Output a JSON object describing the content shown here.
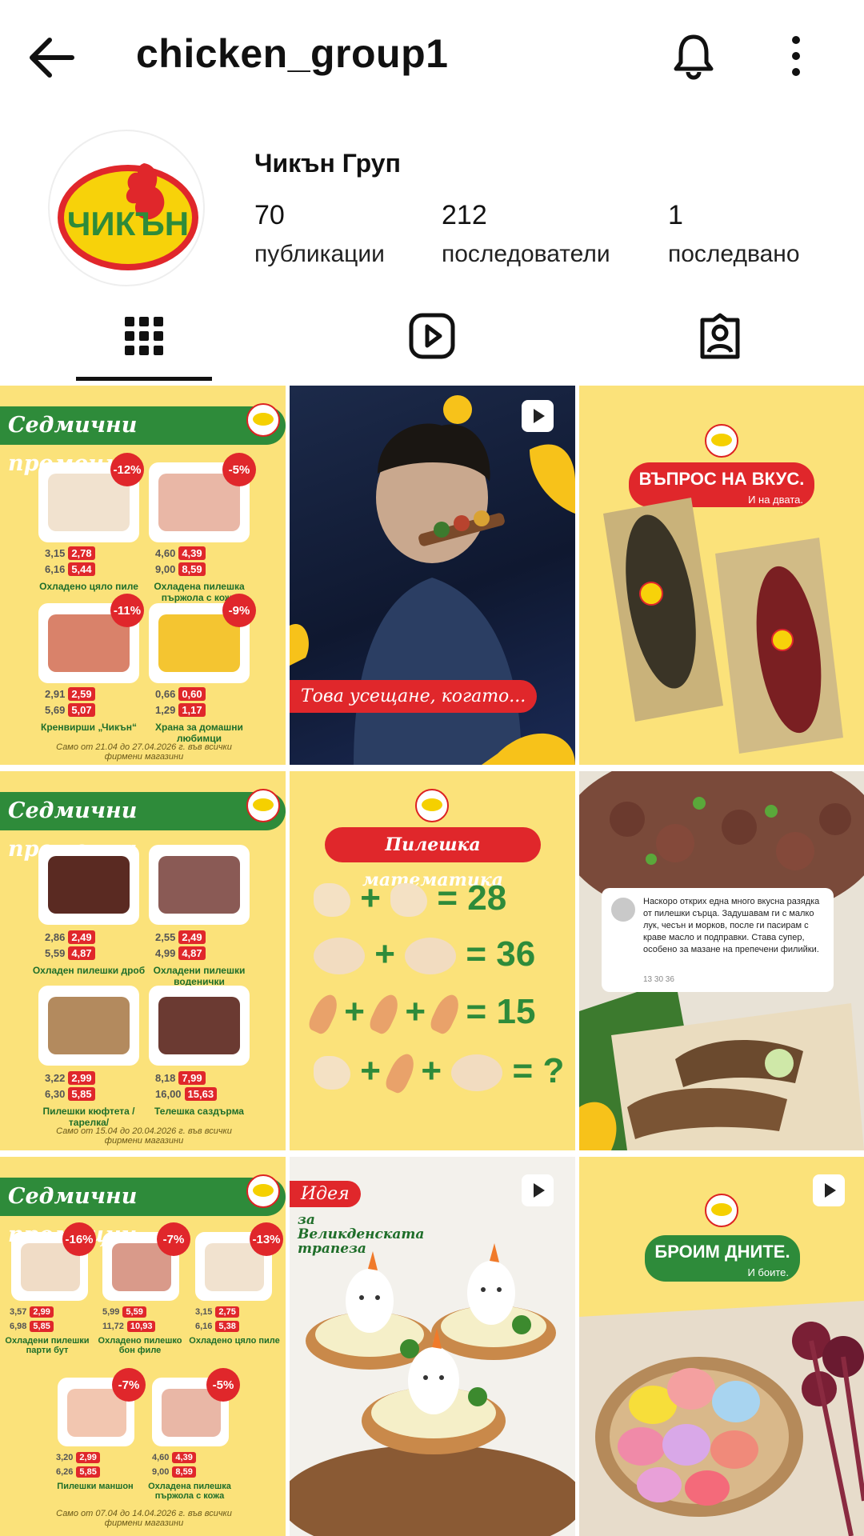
{
  "header": {
    "title": "chicken_group1",
    "back_icon": "arrow-left-icon",
    "bell_icon": "bell-icon",
    "more_icon": "more-vertical-icon"
  },
  "profile": {
    "display_name": "Чикън Груп",
    "logo_text": "ЧИКЪН",
    "stats": {
      "posts": {
        "value": "70",
        "label": "публикации"
      },
      "followers": {
        "value": "212",
        "label": "последователи"
      },
      "following": {
        "value": "1",
        "label": "последвано"
      }
    }
  },
  "tabs": [
    {
      "name": "grid",
      "icon": "grid-icon",
      "active": true
    },
    {
      "name": "reels",
      "icon": "reels-icon",
      "active": false
    },
    {
      "name": "tagged",
      "icon": "tagged-person-icon",
      "active": false
    }
  ],
  "colors": {
    "accent_green": "#2e8b3a",
    "accent_red": "#e0272b",
    "promo_yellow": "#fbe27a"
  },
  "posts": {
    "p1": {
      "title": "Седмични промоции",
      "items": [
        {
          "badge": "-12%",
          "old1": "3,15",
          "new1": "2,78",
          "old2": "6,16",
          "new2": "5,44",
          "name": "Охладено цяло пиле"
        },
        {
          "badge": "-5%",
          "old1": "4,60",
          "new1": "4,39",
          "old2": "9,00",
          "new2": "8,59",
          "name": "Охладена пилешка пържола с кожа"
        },
        {
          "badge": "-11%",
          "old1": "2,91",
          "new1": "2,59",
          "old2": "5,69",
          "new2": "5,07",
          "name": "Кренвирши „Чикън“"
        },
        {
          "badge": "-9%",
          "old1": "0,66",
          "new1": "0,60",
          "old2": "1,29",
          "new2": "1,17",
          "name": "Храна за домашни любимци"
        }
      ],
      "footer": "Само от 21.04 до 27.04.2026 г. във всички фирмени магазини"
    },
    "p2": {
      "caption": "Това усещане, когато..."
    },
    "p3": {
      "title": "ВЪПРОС НА ВКУС.",
      "subtitle": "И на двата."
    },
    "p4": {
      "title": "Седмични промоции",
      "items": [
        {
          "old1": "2,86",
          "new1": "2,49",
          "old2": "5,59",
          "new2": "4,87",
          "name": "Охладен пилешки дроб"
        },
        {
          "old1": "2,55",
          "new1": "2,49",
          "old2": "4,99",
          "new2": "4,87",
          "name": "Охладени пилешки воденички"
        },
        {
          "old1": "3,22",
          "new1": "2,99",
          "old2": "6,30",
          "new2": "5,85",
          "name": "Пилешки кюфтета /тарелка/"
        },
        {
          "old1": "8,18",
          "new1": "7,99",
          "old2": "16,00",
          "new2": "15,63",
          "name": "Телешка саздърма"
        }
      ],
      "footer": "Само от 15.04 до 20.04.2026 г. във всички фирмени магазини"
    },
    "p5": {
      "title": "Пилешка математика",
      "rows": [
        "= 28",
        "= 36",
        "= 15",
        "= ?"
      ]
    },
    "p6": {
      "comment": "Наскоро открих една много вкусна разядка от пилешки сърца. Задушавам ги с малко лук, чесън и морков, после ги пасирам с краве масло и подправки. Става супер, особено за мазане на препечени филийки.",
      "meta": "13   30   36"
    },
    "p7": {
      "title": "Седмични промоции",
      "items": [
        {
          "badge": "-16%",
          "old1": "3,57",
          "new1": "2,99",
          "old2": "6,98",
          "new2": "5,85",
          "name": "Охладени пилешки парти бут"
        },
        {
          "badge": "-7%",
          "old1": "5,99",
          "new1": "5,59",
          "old2": "11,72",
          "new2": "10,93",
          "name": "Охладено пилешко бон филе"
        },
        {
          "badge": "-13%",
          "old1": "3,15",
          "new1": "2,75",
          "old2": "6,16",
          "new2": "5,38",
          "name": "Охладено цяло пиле"
        },
        {
          "badge": "-7%",
          "old1": "3,20",
          "new1": "2,99",
          "old2": "6,26",
          "new2": "5,85",
          "name": "Пилешки маншон"
        },
        {
          "badge": "-5%",
          "old1": "4,60",
          "new1": "4,39",
          "old2": "9,00",
          "new2": "8,59",
          "name": "Охладена пилешка пържола с кожа"
        }
      ],
      "footer": "Само от 07.04 до 14.04.2026 г. във всички фирмени магазини"
    },
    "p8": {
      "tag": "Идея",
      "title": "за Великденската трапеза"
    },
    "p9": {
      "title": "БРОИМ ДНИТЕ.",
      "subtitle": "И боите."
    }
  }
}
